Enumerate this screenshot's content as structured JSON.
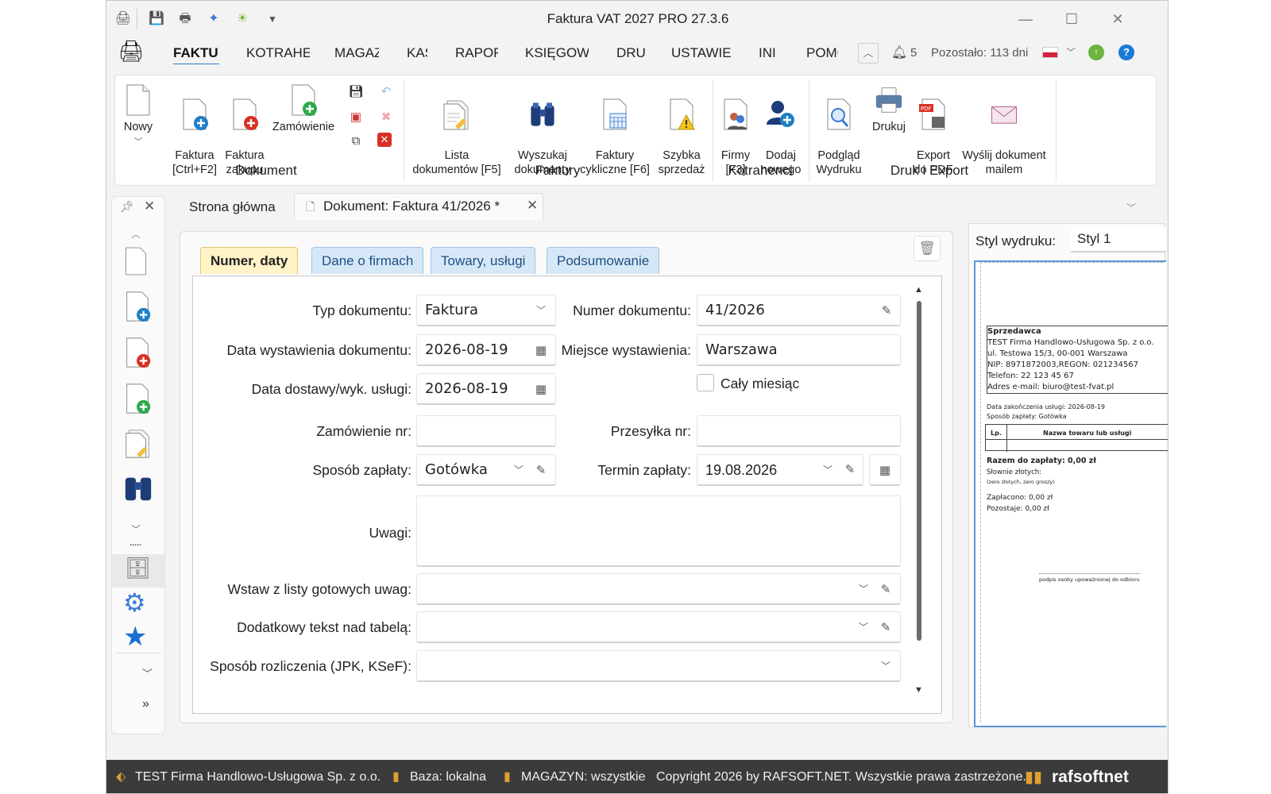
{
  "window": {
    "title": "Faktura VAT 2027 PRO 27.3.6",
    "minimize": "—",
    "maximize": "☐",
    "close": "✕"
  },
  "menu": {
    "items": [
      "FAKTU",
      "KOTRAHE",
      "MAGAZ",
      "KAS",
      "RAPOR",
      "KSIĘGOW",
      "DRU",
      "USTAWIE",
      "INI",
      "POMO"
    ],
    "notifications": "5",
    "remaining": "Pozostało: 113 dni"
  },
  "ribbon": {
    "new": "Nowy",
    "invoice": "Faktura\n[Ctrl+F2]",
    "purchase": "Faktura\nzakupu",
    "order": "Zamówienie",
    "doc_list": "Lista\ndokumentów [F5]",
    "search": "Wyszukaj\ndokumenty",
    "cyclic": "Faktury\ncykliczne [F6]",
    "quick_sale": "Szybka\nsprzedaż",
    "companies": "Firmy\n[F3]",
    "add_new": "Dodaj\nnowego",
    "preview": "Podgląd\nWydruku",
    "print": "Drukuj",
    "pdf": "Export\ndo PDF",
    "email": "Wyślij dokument\nmailem",
    "groups": {
      "document": "Dokument",
      "invoices": "Faktury",
      "contractors": "Kotrahenci",
      "print_export": "Druk i Export"
    }
  },
  "tabs": {
    "home": "Strona główna",
    "document": "Dokument: Faktura 41/2026 *"
  },
  "form_tabs": [
    "Numer, daty",
    "Dane o firmach",
    "Towary, usługi",
    "Podsumowanie"
  ],
  "form": {
    "doc_type_label": "Typ dokumentu:",
    "doc_type": "Faktura",
    "doc_number_label": "Numer dokumentu:",
    "doc_number": "41/2026",
    "issue_date_label": "Data wystawienia dokumentu:",
    "issue_date": "2026-08-19",
    "place_label": "Miejsce wystawienia:",
    "place": "Warszawa",
    "delivery_date_label": "Data dostawy/wyk. usługi:",
    "delivery_date": "2026-08-19",
    "whole_month": "Cały miesiąc",
    "order_no_label": "Zamówienie nr:",
    "order_no": "",
    "shipment_label": "Przesyłka nr:",
    "shipment": "",
    "payment_label": "Sposób zapłaty:",
    "payment": "Gotówka",
    "due_label": "Termin zapłaty:",
    "due": "19.08.2026",
    "notes_label": "Uwagi:",
    "notes": "",
    "ready_notes_label": "Wstaw z listy gotowych uwag:",
    "extra_text_label": "Dodatkowy tekst nad tabelą:",
    "settlement_label": "Sposób rozliczenia (JPK, KSeF):"
  },
  "preview": {
    "style_label": "Styl wydruku:",
    "style": "Styl 1",
    "seller": "Sprzedawca",
    "seller_lines": [
      "TEST Firma Handlowo-Usługowa Sp. z o.o.",
      "ul. Testowa 15/3, 00-001 Warszawa",
      "NIP: 8971872003,REGON: 021234567",
      "Telefon: 22 123 45 67",
      "Adres e-mail: biuro@test-fvat.pl"
    ],
    "completion": "Data zakończenia usługi: 2026-08-19",
    "payment": "Sposób zapłaty: Gotówka",
    "col_lp": "Lp.",
    "col_name": "Nazwa towaru lub usługi",
    "total": "Razem do zapłaty: 0,00 zł",
    "words": "Słownie złotych:",
    "words_val": "(zero złotych, zero groszy)",
    "paid": "Zapłacono: 0,00 zł",
    "left": "Pozostaje: 0,00 zł",
    "signature": "podpis osoby upoważnionej do odbioru"
  },
  "status": {
    "company": "TEST Firma Handlowo-Usługowa Sp. z o.o.",
    "db": "Baza: lokalna",
    "warehouse": "MAGAZYN: wszystkie",
    "copyright": "Copyright 2026 by RAFSOFT.NET. Wszystkie prawa zastrzeżone.",
    "logo": "rafsoftnet"
  },
  "colors": {
    "accent": "#2e7bd6",
    "tab_active": "#fff3c7",
    "tab_inactive": "#d6e8f8",
    "status_bg": "#3b3b3b"
  }
}
